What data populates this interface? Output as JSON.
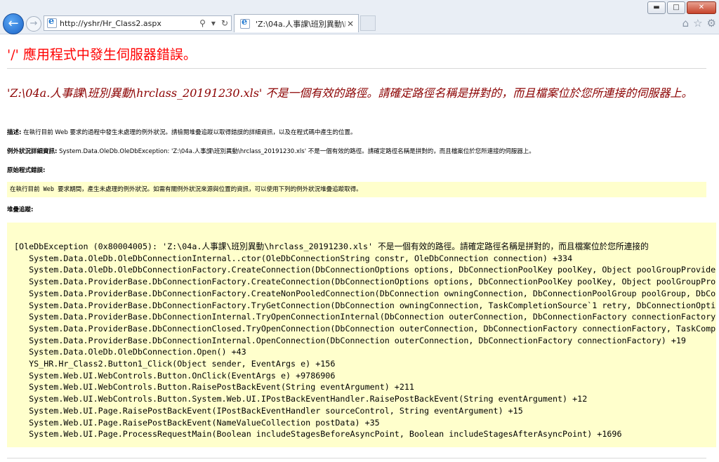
{
  "window": {
    "minimize": "▬",
    "maximize": "□",
    "close": "✕"
  },
  "address": {
    "url": "http://yshr/Hr_Class2.aspx",
    "search_icon": "magnifier-icon",
    "dropdown": "▾",
    "refresh": "↻"
  },
  "tab": {
    "title": "'Z:\\04a.人事課\\班別異動\\h...",
    "close": "✕"
  },
  "page": {
    "heading": "'/' 應用程式中發生伺服器錯誤。",
    "error_message": "'Z:\\04a.人事課\\班別異動\\hrclass_20191230.xls' 不是一個有效的路徑。請確定路徑名稱是拼對的，而且檔案位於您所連接的伺服器上。",
    "desc_label": "描述:",
    "desc_text": " 在執行目前 Web 要求的過程中發生未處理的例外狀況。請檢閱堆疊追蹤以取得錯誤的詳細資訊，以及在程式碼中產生的位置。",
    "exc_label": "例外狀況詳細資訊:",
    "exc_text": " System.Data.OleDb.OleDbException: 'Z:\\04a.人事課\\班別異動\\hrclass_20191230.xls' 不是一個有效的路徑。請確定路徑名稱是拼對的，而且檔案位於您所連接的伺服器上。",
    "src_label": "原始程式錯誤:",
    "src_note": "在執行目前 Web 要求期間，產生未處理的例外狀況。如需有關例外狀況來源與位置的資訊，可以使用下列的例外狀況堆疊追蹤取得。",
    "stack_label": "堆疊追蹤:",
    "stack_lines": [
      "[OleDbException (0x80004005): 'Z:\\04a.人事課\\班別異動\\hrclass_20191230.xls' 不是一個有效的路徑。請確定路徑名稱是拼對的，而且檔案位於您所連接的",
      "   System.Data.OleDb.OleDbConnectionInternal..ctor(OleDbConnectionString constr, OleDbConnection connection) +334",
      "   System.Data.OleDb.OleDbConnectionFactory.CreateConnection(DbConnectionOptions options, DbConnectionPoolKey poolKey, Object poolGroupProvide",
      "   System.Data.ProviderBase.DbConnectionFactory.CreateConnection(DbConnectionOptions options, DbConnectionPoolKey poolKey, Object poolGroupPro",
      "   System.Data.ProviderBase.DbConnectionFactory.CreateNonPooledConnection(DbConnection owningConnection, DbConnectionPoolGroup poolGroup, DbCo",
      "   System.Data.ProviderBase.DbConnectionFactory.TryGetConnection(DbConnection owningConnection, TaskCompletionSource`1 retry, DbConnectionOpti",
      "   System.Data.ProviderBase.DbConnectionInternal.TryOpenConnectionInternal(DbConnection outerConnection, DbConnectionFactory connectionFactory",
      "   System.Data.ProviderBase.DbConnectionClosed.TryOpenConnection(DbConnection outerConnection, DbConnectionFactory connectionFactory, TaskComp",
      "   System.Data.ProviderBase.DbConnectionInternal.OpenConnection(DbConnection outerConnection, DbConnectionFactory connectionFactory) +19",
      "   System.Data.OleDb.OleDbConnection.Open() +43",
      "   YS_HR.Hr_Class2.Button1_Click(Object sender, EventArgs e) +156",
      "   System.Web.UI.WebControls.Button.OnClick(EventArgs e) +9786906",
      "   System.Web.UI.WebControls.Button.RaisePostBackEvent(String eventArgument) +211",
      "   System.Web.UI.WebControls.Button.System.Web.UI.IPostBackEventHandler.RaisePostBackEvent(String eventArgument) +12",
      "   System.Web.UI.Page.RaisePostBackEvent(IPostBackEventHandler sourceControl, String eventArgument) +15",
      "   System.Web.UI.Page.RaisePostBackEvent(NameValueCollection postData) +35",
      "   System.Web.UI.Page.ProcessRequestMain(Boolean includeStagesBeforeAsyncPoint, Boolean includeStagesAfterAsyncPoint) +1696"
    ]
  }
}
